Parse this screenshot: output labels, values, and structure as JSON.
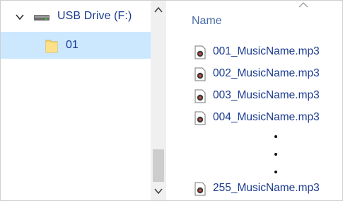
{
  "nav_pane": {
    "drive": {
      "label": "USB Drive (F:)",
      "icon": "usb-drive-icon",
      "expanded": true
    },
    "folders": [
      {
        "label": "01",
        "icon": "folder-icon",
        "selected": true
      }
    ]
  },
  "file_list": {
    "column_header": "Name",
    "files": [
      {
        "name": "001_MusicName.mp3",
        "icon": "mp3-file-icon"
      },
      {
        "name": "002_MusicName.mp3",
        "icon": "mp3-file-icon"
      },
      {
        "name": "003_MusicName.mp3",
        "icon": "mp3-file-icon"
      },
      {
        "name": "004_MusicName.mp3",
        "icon": "mp3-file-icon"
      },
      {
        "name": "255_MusicName.mp3",
        "icon": "mp3-file-icon"
      }
    ]
  },
  "colors": {
    "selection": "#cce8ff",
    "link_text": "#1a3a8f",
    "header_text": "#4a6da7",
    "scrollbar_thumb": "#cdcdcd"
  }
}
